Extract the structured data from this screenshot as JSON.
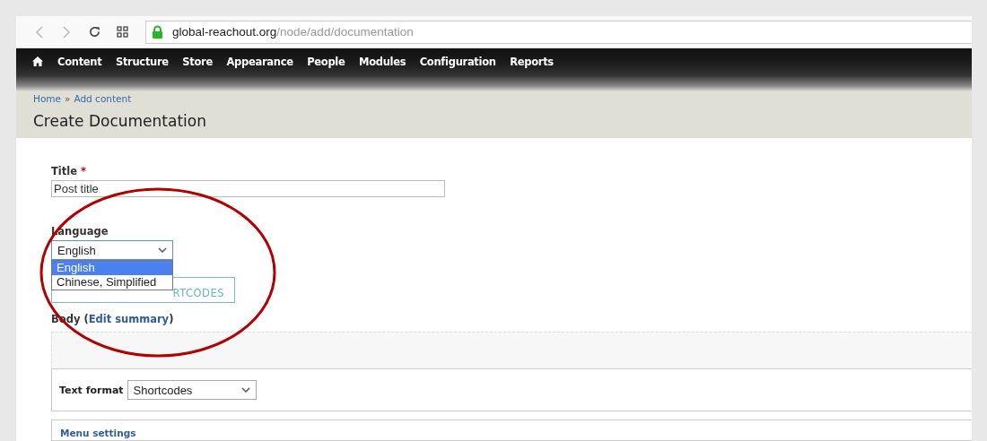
{
  "browser": {
    "url_host": "global-reachout.org",
    "url_path": "/node/add/documentation",
    "secure": true
  },
  "nav": {
    "items": [
      {
        "label": "Content"
      },
      {
        "label": "Structure"
      },
      {
        "label": "Store"
      },
      {
        "label": "Appearance"
      },
      {
        "label": "People"
      },
      {
        "label": "Modules"
      },
      {
        "label": "Configuration"
      },
      {
        "label": "Reports"
      }
    ]
  },
  "breadcrumb": {
    "items": [
      {
        "label": "Home"
      },
      {
        "label": "Add content"
      }
    ],
    "separator": "»"
  },
  "page_title": "Create Documentation",
  "form": {
    "title_field": {
      "label": "Title",
      "required_mark": "*",
      "value": "Post title"
    },
    "language": {
      "label": "Language",
      "value": "English",
      "expanded": true,
      "options": [
        {
          "label": "English",
          "selected": true
        },
        {
          "label": "Chinese, Simplified",
          "selected": false
        }
      ]
    },
    "shortcodes_button": {
      "label": "RTCODES"
    },
    "body": {
      "label_start": "Body (",
      "link": "Edit summary",
      "label_end": ")"
    },
    "text_format": {
      "label": "Text format",
      "value": "Shortcodes"
    },
    "menu_settings": {
      "label": "Menu settings"
    }
  }
}
